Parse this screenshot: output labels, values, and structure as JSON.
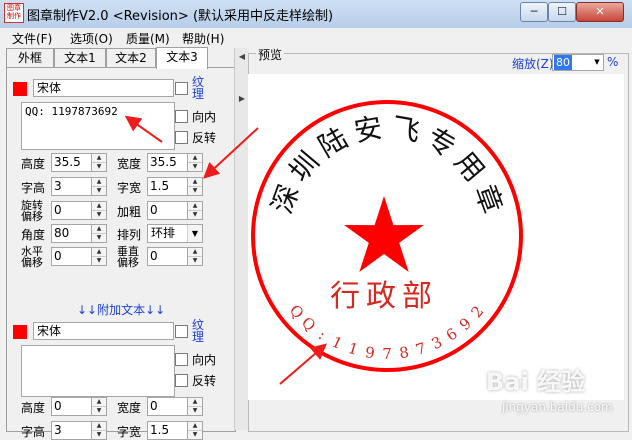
{
  "window": {
    "title": "图章制作V2.0 <Revision> (默认采用中反走样绘制)",
    "icon_text": "图章\n制作",
    "buttons": [
      "─",
      "☐",
      "✕"
    ]
  },
  "menu": [
    "文件(F)",
    "选项(O)",
    "质量(M)",
    "帮助(H)"
  ],
  "tabs": [
    {
      "label": "外框",
      "active": false
    },
    {
      "label": "文本1",
      "active": false
    },
    {
      "label": "文本2",
      "active": false
    },
    {
      "label": "文本3",
      "active": true
    }
  ],
  "text3": {
    "color": "#ff0000",
    "font": "宋体",
    "content": "QQ: 1197873692",
    "checkbox_pattern": "纹理",
    "checkbox_inward": "向内",
    "checkbox_reverse": "反转",
    "labels": {
      "height": "高度",
      "width": "宽度",
      "char_height": "字高",
      "char_width": "字宽",
      "rotate_offset": "旋转偏移",
      "bold": "加粗",
      "angle": "角度",
      "arrange": "排列",
      "h_offset": "水平偏移",
      "v_offset": "垂直偏移"
    },
    "values": {
      "height": "35.5",
      "width": "35.5",
      "char_height": "3",
      "char_width": "1.5",
      "rotate_offset": "0",
      "bold": "0",
      "angle": "80",
      "arrange": "环排",
      "h_offset": "0",
      "v_offset": "0"
    }
  },
  "extra_link": "↓↓附加文本↓↓",
  "extra": {
    "color": "#ff0000",
    "font": "宋体",
    "content": "",
    "checkbox_pattern": "纹理",
    "checkbox_inward": "向内",
    "checkbox_reverse": "反转",
    "labels": {
      "height": "高度",
      "width": "宽度",
      "char_height": "字高",
      "char_width": "字宽"
    },
    "values": {
      "height": "0",
      "width": "0",
      "char_height": "3",
      "char_width": "1.5"
    }
  },
  "preview": {
    "caption": "预览",
    "zoom_label": "缩放(Z)",
    "zoom_value": "80",
    "zoom_unit": "%"
  },
  "stamp": {
    "border_color": "#ff0000",
    "top_text": [
      "深",
      "圳",
      "陆",
      "安",
      "飞",
      "专",
      "用",
      "章"
    ],
    "center_text": "行政部",
    "bottom_text": "QQ:1197873692",
    "star_color": "#ff0000"
  },
  "watermark": {
    "main": "Bai 经验",
    "sub": "jingyan.baidu.com"
  }
}
